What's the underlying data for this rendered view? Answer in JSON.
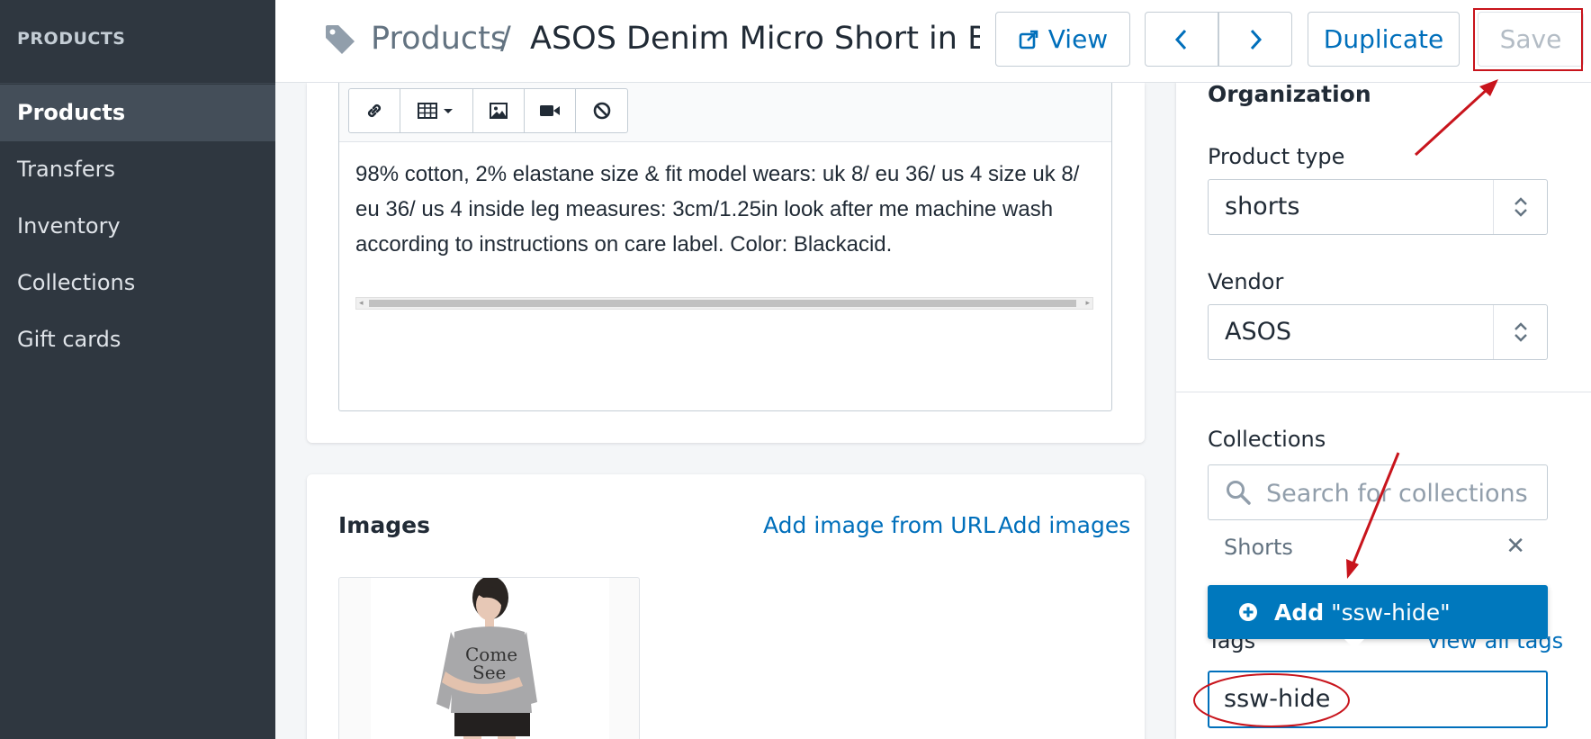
{
  "sidebar": {
    "heading": "PRODUCTS",
    "items": [
      {
        "label": "Products",
        "active": true
      },
      {
        "label": "Transfers"
      },
      {
        "label": "Inventory"
      },
      {
        "label": "Collections"
      },
      {
        "label": "Gift cards"
      }
    ]
  },
  "header": {
    "breadcrumb_root": "Products",
    "breadcrumb_sep": "/",
    "title": "ASOS Denim Micro Short in Bl...",
    "view_label": "View",
    "duplicate_label": "Duplicate",
    "save_label": "Save"
  },
  "editor": {
    "text": "98% cotton, 2% elastane size & fit model wears: uk 8/ eu 36/ us 4 size uk 8/ eu 36/ us 4 inside leg measures: 3cm/1.25in look after me machine wash according to instructions on care label. Color: Blackacid.",
    "tools": [
      "link-icon",
      "table-icon",
      "image-icon",
      "video-icon",
      "clear-format-icon"
    ]
  },
  "images": {
    "title": "Images",
    "add_from_url": "Add image from URL",
    "add_images": "Add images"
  },
  "organization": {
    "title": "Organization",
    "product_type_label": "Product type",
    "product_type_value": "shorts",
    "vendor_label": "Vendor",
    "vendor_value": "ASOS",
    "collections_label": "Collections",
    "collections_placeholder": "Search for collections",
    "collections": [
      "Shorts"
    ],
    "tags_label": "Tags",
    "view_all_tags": "View all tags",
    "tags_value": "ssw-hide",
    "dropdown_add": "Add",
    "dropdown_value": "\"ssw-hide\""
  },
  "colors": {
    "sidebar_bg": "#2f3740",
    "link_blue": "#006fbb",
    "dropdown_blue": "#0078bd",
    "annotation_red": "#c8141c"
  }
}
